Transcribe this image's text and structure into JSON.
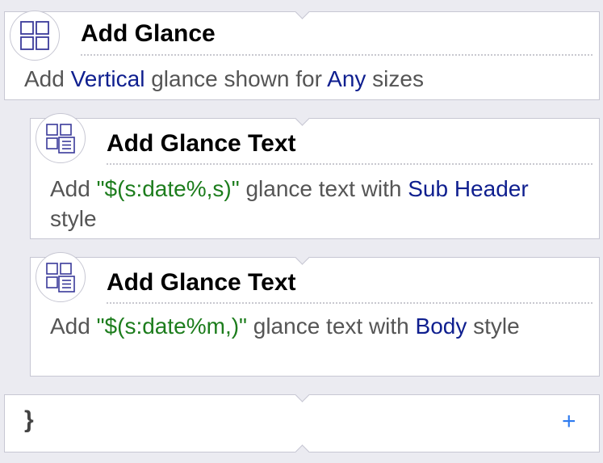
{
  "actions": [
    {
      "title": "Add Glance",
      "icon": "glance-grid-icon",
      "desc": [
        {
          "text": "Add "
        },
        {
          "text": "Vertical",
          "token": "blue"
        },
        {
          "text": " glance shown for "
        },
        {
          "text": "Any",
          "token": "blue"
        },
        {
          "text": " sizes"
        }
      ]
    },
    {
      "title": "Add Glance Text",
      "icon": "glance-text-icon",
      "desc": [
        {
          "text": "Add "
        },
        {
          "text": "\"$(s:date%,s)\"",
          "token": "green"
        },
        {
          "text": " glance text with "
        },
        {
          "text": "Sub Header",
          "token": "blue"
        },
        {
          "text": " style"
        }
      ]
    },
    {
      "title": "Add Glance Text",
      "icon": "glance-text-icon",
      "desc": [
        {
          "text": "Add "
        },
        {
          "text": "\"$(s:date%m,)\"",
          "token": "green"
        },
        {
          "text": " glance text with "
        },
        {
          "text": "Body",
          "token": "blue"
        },
        {
          "text": " style"
        }
      ]
    }
  ],
  "footer": {
    "brace": "}",
    "add_label": "+"
  },
  "colors": {
    "background": "#ebebf1",
    "variable_blue": "#0f1f8f",
    "string_green": "#1d7d1d",
    "add_blue": "#2e7bf0"
  }
}
